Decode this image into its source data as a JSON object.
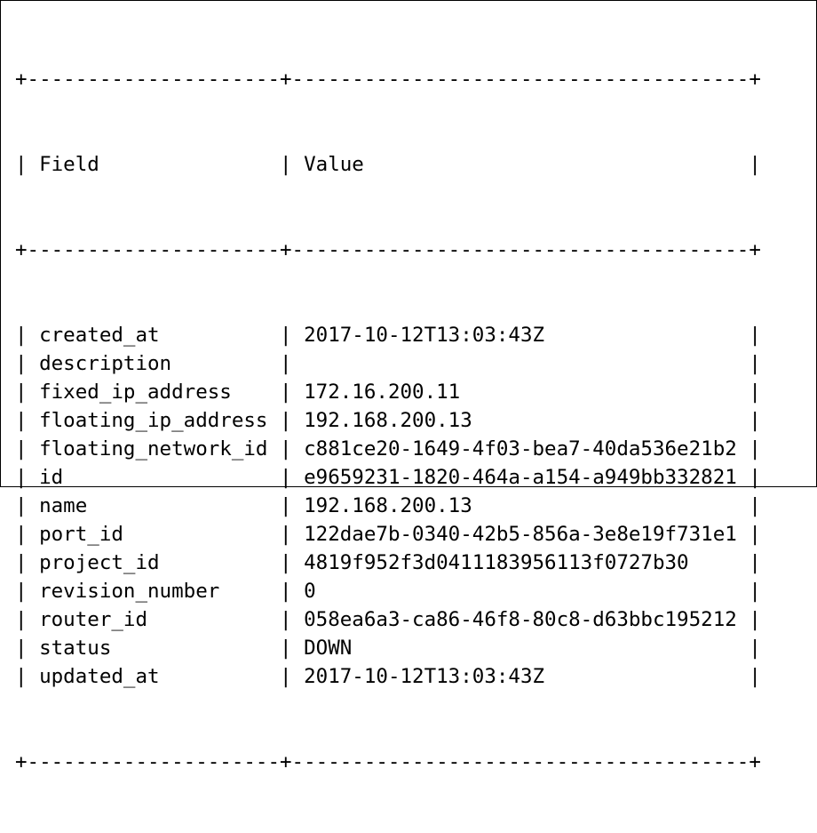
{
  "table": {
    "headers": {
      "field": "Field",
      "value": "Value"
    },
    "rows": [
      {
        "field": "created_at",
        "value": "2017-10-12T13:03:43Z"
      },
      {
        "field": "description",
        "value": ""
      },
      {
        "field": "fixed_ip_address",
        "value": "172.16.200.11"
      },
      {
        "field": "floating_ip_address",
        "value": "192.168.200.13"
      },
      {
        "field": "floating_network_id",
        "value": "c881ce20-1649-4f03-bea7-40da536e21b2"
      },
      {
        "field": "id",
        "value": "e9659231-1820-464a-a154-a949bb332821"
      },
      {
        "field": "name",
        "value": "192.168.200.13"
      },
      {
        "field": "port_id",
        "value": "122dae7b-0340-42b5-856a-3e8e19f731e1"
      },
      {
        "field": "project_id",
        "value": "4819f952f3d0411183956113f0727b30"
      },
      {
        "field": "revision_number",
        "value": "0"
      },
      {
        "field": "router_id",
        "value": "058ea6a3-ca86-46f8-80c8-d63bbc195212"
      },
      {
        "field": "status",
        "value": "DOWN"
      },
      {
        "field": "updated_at",
        "value": "2017-10-12T13:03:43Z"
      }
    ]
  }
}
